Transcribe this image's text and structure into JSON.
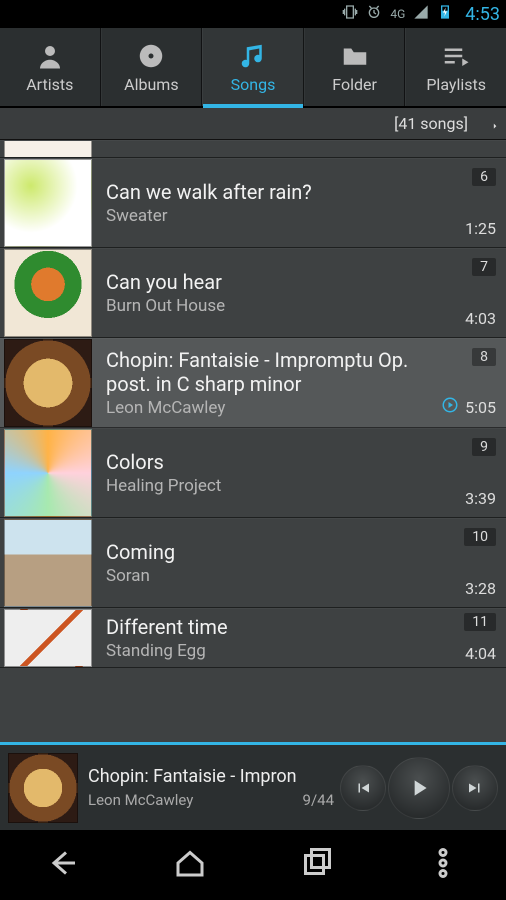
{
  "status": {
    "time": "4:53",
    "network_label": "4G"
  },
  "tabs": [
    {
      "id": "artists",
      "label": "Artists"
    },
    {
      "id": "albums",
      "label": "Albums"
    },
    {
      "id": "songs",
      "label": "Songs"
    },
    {
      "id": "folder",
      "label": "Folder"
    },
    {
      "id": "playlists",
      "label": "Playlists"
    }
  ],
  "active_tab": "songs",
  "sub_header": {
    "count_label": "[41 songs]"
  },
  "songs": [
    {
      "title": "Can we walk after rain?",
      "artist": "Sweater",
      "track": "6",
      "duration": "1:25",
      "art": "art-green"
    },
    {
      "title": "Can you hear",
      "artist": "Burn Out House",
      "track": "7",
      "duration": "4:03",
      "art": "art-tree"
    },
    {
      "title": "Chopin: Fantaisie - Impromptu Op. post. in C sharp minor",
      "artist": "Leon McCawley",
      "track": "8",
      "duration": "5:05",
      "art": "art-dandelion",
      "playing": true
    },
    {
      "title": "Colors",
      "artist": "Healing Project",
      "track": "9",
      "duration": "3:39",
      "art": "art-colors"
    },
    {
      "title": "Coming",
      "artist": "Soran",
      "track": "10",
      "duration": "3:28",
      "art": "art-street"
    },
    {
      "title": "Different time",
      "artist": "Standing Egg",
      "track": "11",
      "duration": "4:04",
      "art": "art-desk"
    }
  ],
  "now_playing": {
    "title": "Chopin: Fantaisie - Impron",
    "artist": "Leon McCawley",
    "position": "9/44",
    "art": "art-dandelion"
  }
}
